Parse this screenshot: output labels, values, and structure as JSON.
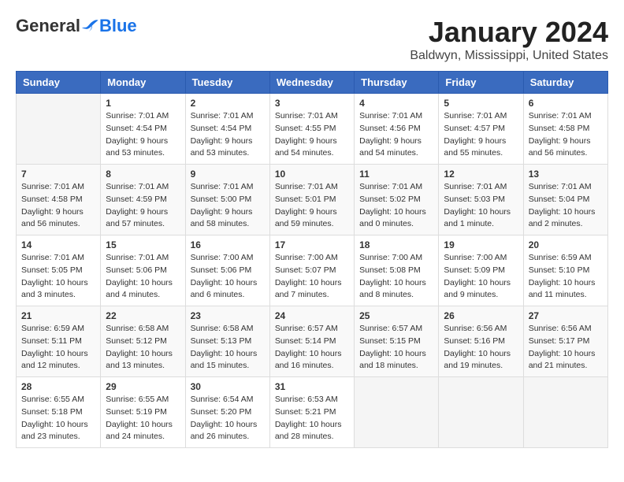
{
  "logo": {
    "general": "General",
    "blue": "Blue"
  },
  "title": "January 2024",
  "subtitle": "Baldwyn, Mississippi, United States",
  "days_of_week": [
    "Sunday",
    "Monday",
    "Tuesday",
    "Wednesday",
    "Thursday",
    "Friday",
    "Saturday"
  ],
  "weeks": [
    [
      {
        "day": null,
        "sunrise": null,
        "sunset": null,
        "daylight": null
      },
      {
        "day": "1",
        "sunrise": "Sunrise: 7:01 AM",
        "sunset": "Sunset: 4:54 PM",
        "daylight": "Daylight: 9 hours and 53 minutes."
      },
      {
        "day": "2",
        "sunrise": "Sunrise: 7:01 AM",
        "sunset": "Sunset: 4:54 PM",
        "daylight": "Daylight: 9 hours and 53 minutes."
      },
      {
        "day": "3",
        "sunrise": "Sunrise: 7:01 AM",
        "sunset": "Sunset: 4:55 PM",
        "daylight": "Daylight: 9 hours and 54 minutes."
      },
      {
        "day": "4",
        "sunrise": "Sunrise: 7:01 AM",
        "sunset": "Sunset: 4:56 PM",
        "daylight": "Daylight: 9 hours and 54 minutes."
      },
      {
        "day": "5",
        "sunrise": "Sunrise: 7:01 AM",
        "sunset": "Sunset: 4:57 PM",
        "daylight": "Daylight: 9 hours and 55 minutes."
      },
      {
        "day": "6",
        "sunrise": "Sunrise: 7:01 AM",
        "sunset": "Sunset: 4:58 PM",
        "daylight": "Daylight: 9 hours and 56 minutes."
      }
    ],
    [
      {
        "day": "7",
        "sunrise": "Sunrise: 7:01 AM",
        "sunset": "Sunset: 4:58 PM",
        "daylight": "Daylight: 9 hours and 56 minutes."
      },
      {
        "day": "8",
        "sunrise": "Sunrise: 7:01 AM",
        "sunset": "Sunset: 4:59 PM",
        "daylight": "Daylight: 9 hours and 57 minutes."
      },
      {
        "day": "9",
        "sunrise": "Sunrise: 7:01 AM",
        "sunset": "Sunset: 5:00 PM",
        "daylight": "Daylight: 9 hours and 58 minutes."
      },
      {
        "day": "10",
        "sunrise": "Sunrise: 7:01 AM",
        "sunset": "Sunset: 5:01 PM",
        "daylight": "Daylight: 9 hours and 59 minutes."
      },
      {
        "day": "11",
        "sunrise": "Sunrise: 7:01 AM",
        "sunset": "Sunset: 5:02 PM",
        "daylight": "Daylight: 10 hours and 0 minutes."
      },
      {
        "day": "12",
        "sunrise": "Sunrise: 7:01 AM",
        "sunset": "Sunset: 5:03 PM",
        "daylight": "Daylight: 10 hours and 1 minute."
      },
      {
        "day": "13",
        "sunrise": "Sunrise: 7:01 AM",
        "sunset": "Sunset: 5:04 PM",
        "daylight": "Daylight: 10 hours and 2 minutes."
      }
    ],
    [
      {
        "day": "14",
        "sunrise": "Sunrise: 7:01 AM",
        "sunset": "Sunset: 5:05 PM",
        "daylight": "Daylight: 10 hours and 3 minutes."
      },
      {
        "day": "15",
        "sunrise": "Sunrise: 7:01 AM",
        "sunset": "Sunset: 5:06 PM",
        "daylight": "Daylight: 10 hours and 4 minutes."
      },
      {
        "day": "16",
        "sunrise": "Sunrise: 7:00 AM",
        "sunset": "Sunset: 5:06 PM",
        "daylight": "Daylight: 10 hours and 6 minutes."
      },
      {
        "day": "17",
        "sunrise": "Sunrise: 7:00 AM",
        "sunset": "Sunset: 5:07 PM",
        "daylight": "Daylight: 10 hours and 7 minutes."
      },
      {
        "day": "18",
        "sunrise": "Sunrise: 7:00 AM",
        "sunset": "Sunset: 5:08 PM",
        "daylight": "Daylight: 10 hours and 8 minutes."
      },
      {
        "day": "19",
        "sunrise": "Sunrise: 7:00 AM",
        "sunset": "Sunset: 5:09 PM",
        "daylight": "Daylight: 10 hours and 9 minutes."
      },
      {
        "day": "20",
        "sunrise": "Sunrise: 6:59 AM",
        "sunset": "Sunset: 5:10 PM",
        "daylight": "Daylight: 10 hours and 11 minutes."
      }
    ],
    [
      {
        "day": "21",
        "sunrise": "Sunrise: 6:59 AM",
        "sunset": "Sunset: 5:11 PM",
        "daylight": "Daylight: 10 hours and 12 minutes."
      },
      {
        "day": "22",
        "sunrise": "Sunrise: 6:58 AM",
        "sunset": "Sunset: 5:12 PM",
        "daylight": "Daylight: 10 hours and 13 minutes."
      },
      {
        "day": "23",
        "sunrise": "Sunrise: 6:58 AM",
        "sunset": "Sunset: 5:13 PM",
        "daylight": "Daylight: 10 hours and 15 minutes."
      },
      {
        "day": "24",
        "sunrise": "Sunrise: 6:57 AM",
        "sunset": "Sunset: 5:14 PM",
        "daylight": "Daylight: 10 hours and 16 minutes."
      },
      {
        "day": "25",
        "sunrise": "Sunrise: 6:57 AM",
        "sunset": "Sunset: 5:15 PM",
        "daylight": "Daylight: 10 hours and 18 minutes."
      },
      {
        "day": "26",
        "sunrise": "Sunrise: 6:56 AM",
        "sunset": "Sunset: 5:16 PM",
        "daylight": "Daylight: 10 hours and 19 minutes."
      },
      {
        "day": "27",
        "sunrise": "Sunrise: 6:56 AM",
        "sunset": "Sunset: 5:17 PM",
        "daylight": "Daylight: 10 hours and 21 minutes."
      }
    ],
    [
      {
        "day": "28",
        "sunrise": "Sunrise: 6:55 AM",
        "sunset": "Sunset: 5:18 PM",
        "daylight": "Daylight: 10 hours and 23 minutes."
      },
      {
        "day": "29",
        "sunrise": "Sunrise: 6:55 AM",
        "sunset": "Sunset: 5:19 PM",
        "daylight": "Daylight: 10 hours and 24 minutes."
      },
      {
        "day": "30",
        "sunrise": "Sunrise: 6:54 AM",
        "sunset": "Sunset: 5:20 PM",
        "daylight": "Daylight: 10 hours and 26 minutes."
      },
      {
        "day": "31",
        "sunrise": "Sunrise: 6:53 AM",
        "sunset": "Sunset: 5:21 PM",
        "daylight": "Daylight: 10 hours and 28 minutes."
      },
      {
        "day": null,
        "sunrise": null,
        "sunset": null,
        "daylight": null
      },
      {
        "day": null,
        "sunrise": null,
        "sunset": null,
        "daylight": null
      },
      {
        "day": null,
        "sunrise": null,
        "sunset": null,
        "daylight": null
      }
    ]
  ]
}
